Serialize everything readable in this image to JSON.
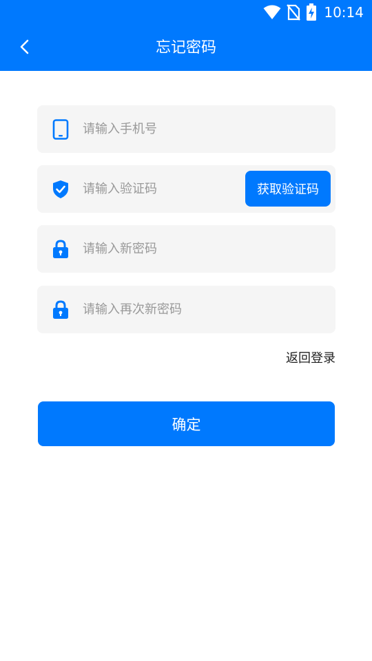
{
  "status_bar": {
    "time": "10:14",
    "icons": [
      "wifi-icon",
      "no-sim-icon",
      "battery-charging-icon"
    ]
  },
  "header": {
    "title": "忘记密码",
    "back_icon": "chevron-left-icon"
  },
  "form": {
    "phone": {
      "placeholder": "请输入手机号",
      "value": "",
      "icon": "phone-icon"
    },
    "code": {
      "placeholder": "请输入验证码",
      "value": "",
      "icon": "shield-check-icon",
      "button_label": "获取验证码"
    },
    "new_password": {
      "placeholder": "请输入新密码",
      "value": "",
      "icon": "lock-icon"
    },
    "confirm_password": {
      "placeholder": "请输入再次新密码",
      "value": "",
      "icon": "lock-icon"
    }
  },
  "links": {
    "back_to_login": "返回登录"
  },
  "actions": {
    "confirm_label": "确定"
  },
  "colors": {
    "primary": "#0079fe",
    "field_bg": "#f5f5f5",
    "placeholder": "#999999"
  }
}
